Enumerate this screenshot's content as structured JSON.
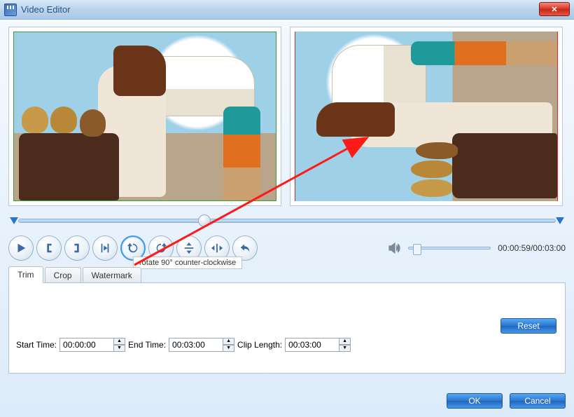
{
  "window": {
    "title": "Video Editor"
  },
  "tooltip": "rotate 90° counter-clockwise",
  "time": {
    "current": "00:00:59",
    "total": "00:03:00"
  },
  "tabs": {
    "trim": "Trim",
    "crop": "Crop",
    "watermark": "Watermark"
  },
  "trim": {
    "start_label": "Start Time:",
    "start_value": "00:00:00",
    "end_label": "End Time:",
    "end_value": "00:03:00",
    "length_label": "Clip Length:",
    "length_value": "00:03:00",
    "reset": "Reset"
  },
  "buttons": {
    "ok": "OK",
    "cancel": "Cancel"
  },
  "transport_icons": {
    "play": "play-icon",
    "mark_in": "mark-in-icon",
    "mark_out": "mark-out-icon",
    "play_range": "play-range-icon",
    "rotate_ccw": "rotate-ccw-icon",
    "rotate_cw": "rotate-cw-icon",
    "flip_v": "flip-vertical-icon",
    "flip_h": "flip-horizontal-icon",
    "undo": "undo-icon"
  }
}
